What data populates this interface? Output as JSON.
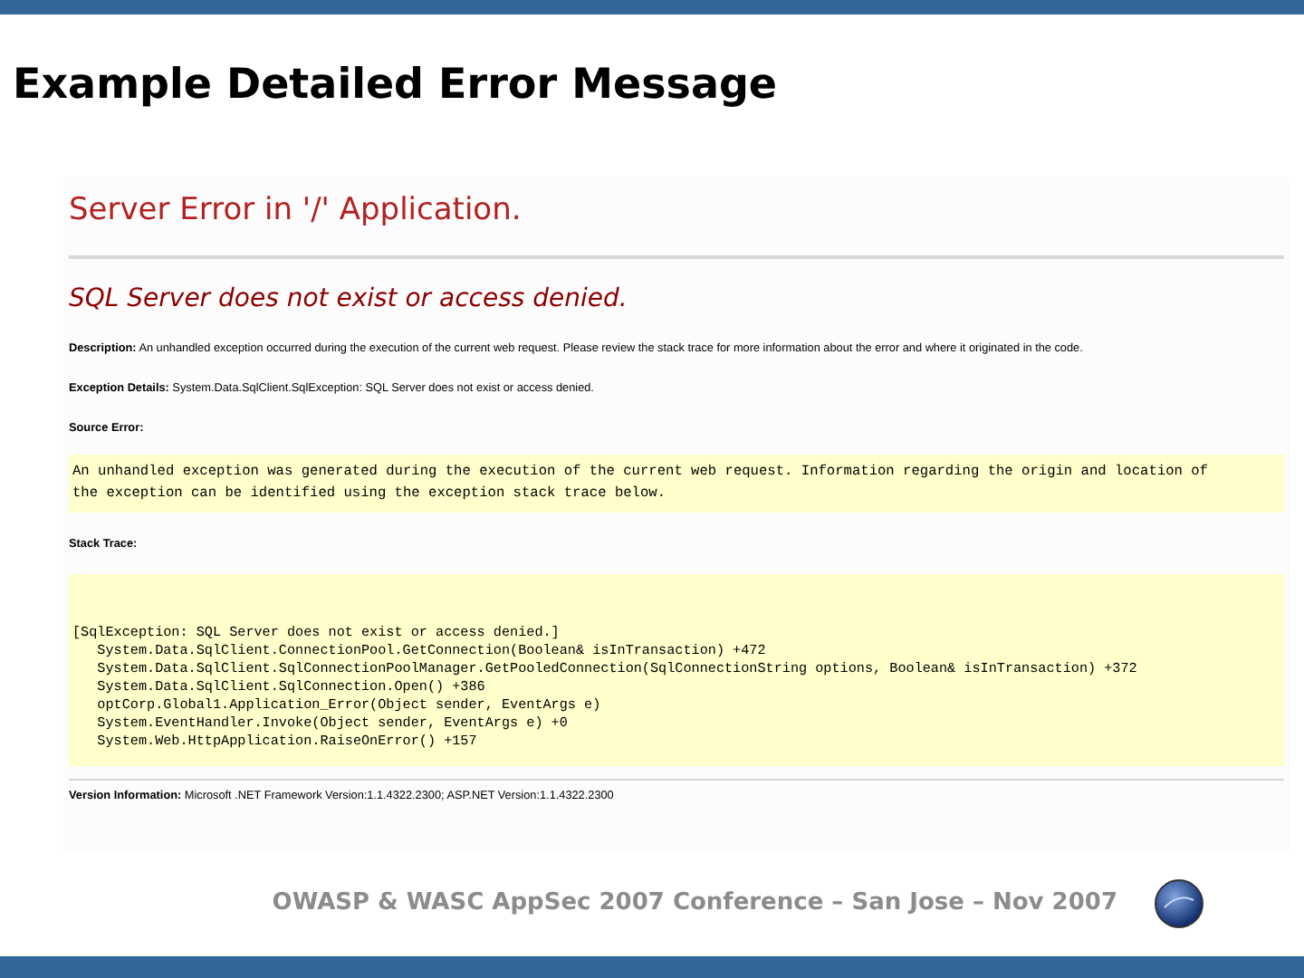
{
  "slide_title": "Example Detailed Error Message",
  "error_page": {
    "heading": "Server Error in '/' Application.",
    "message": "SQL Server does not exist or access denied.",
    "details": [
      "**Description:** An unhandled exception occurred during the execution of the current web request. Please review the stack trace for more information about the error and where it originated in the code.",
      "**Exception Details:** System.Data.SqlClient.SqlException: SQL Server does not exist or access denied."
    ],
    "source_error_label": "Source Error:",
    "source_error": [
      "An unhandled exception was generated during the execution of the current web request. Information regarding the origin and location of",
      "the exception can be identified using the exception stack trace below."
    ],
    "stack_trace_label": "Stack Trace:",
    "stack_trace": [
      "[SqlException: SQL Server does not exist or access denied.]",
      "   System.Data.SqlClient.ConnectionPool.GetConnection(Boolean& isInTransaction) +472",
      "   System.Data.SqlClient.SqlConnectionPoolManager.GetPooledConnection(SqlConnectionString options, Boolean& isInTransaction) +372",
      "   System.Data.SqlClient.SqlConnection.Open() +386",
      "   optCorp.Global1.Application_Error(Object sender, EventArgs e)",
      "   System.EventHandler.Invoke(Object sender, EventArgs e) +0",
      "   System.Web.HttpApplication.RaiseOnError() +157"
    ],
    "version": "**Version Information:** Microsoft .NET Framework Version:1.1.4322.2300; ASP.NET Version:1.1.4322.2300"
  },
  "footer": "OWASP & WASC AppSec 2007 Conference – San Jose – Nov 2007"
}
